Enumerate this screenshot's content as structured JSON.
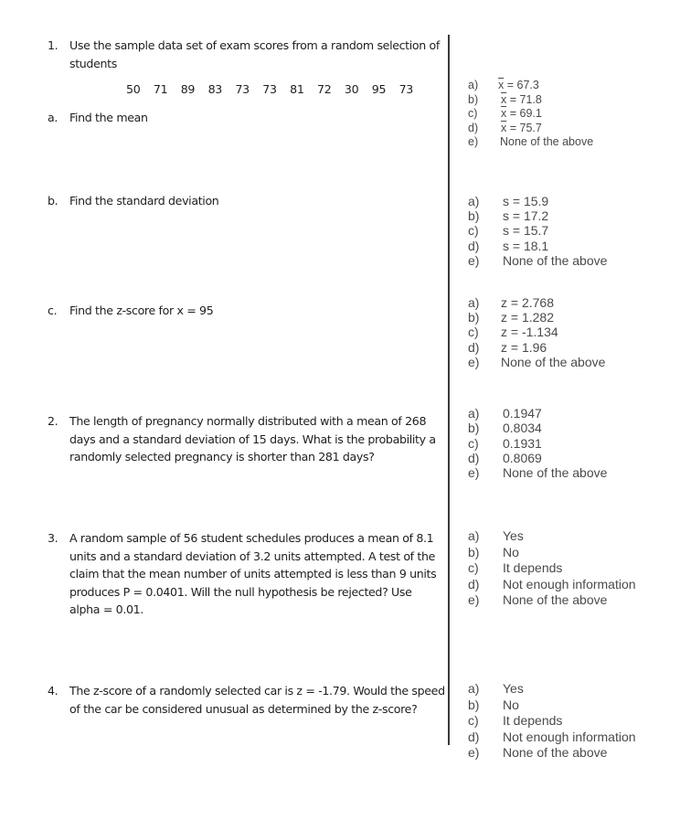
{
  "questions": [
    {
      "number": "1.",
      "text": "Use the sample data set of exam scores from a random selection of students",
      "dataset": [
        "50",
        "71",
        "89",
        "83",
        "73",
        "73",
        "81",
        "72",
        "30",
        "95",
        "73"
      ],
      "parts": [
        {
          "label": "a.",
          "text": "Find the mean",
          "options": [
            {
              "letter": "a)",
              "symbol": "x",
              "text": " = 67.3"
            },
            {
              "letter": "b)",
              "symbol": "x",
              "text": " = 71.8"
            },
            {
              "letter": "c)",
              "symbol": "x",
              "text": " = 69.1"
            },
            {
              "letter": "d)",
              "symbol": "x",
              "text": " = 75.7"
            },
            {
              "letter": "e)",
              "text": "None of the above"
            }
          ]
        },
        {
          "label": "b.",
          "text": "Find the standard deviation",
          "options": [
            {
              "letter": "a)",
              "text": "s = 15.9"
            },
            {
              "letter": "b)",
              "text": "s = 17.2"
            },
            {
              "letter": "c)",
              "text": "s = 15.7"
            },
            {
              "letter": "d)",
              "text": "s = 18.1"
            },
            {
              "letter": "e)",
              "text": "None of the above"
            }
          ]
        },
        {
          "label": "c.",
          "text": "Find the z-score for x = 95",
          "options": [
            {
              "letter": "a)",
              "text": "z = 2.768"
            },
            {
              "letter": "b)",
              "text": "z = 1.282"
            },
            {
              "letter": "c)",
              "text": "z = -1.134"
            },
            {
              "letter": "d)",
              "text": "z = 1.96"
            },
            {
              "letter": "e)",
              "text": "None of the above"
            }
          ]
        }
      ]
    },
    {
      "number": "2.",
      "text": "The length of pregnancy normally distributed with a mean of 268 days and a standard deviation of 15 days.  What is the probability a randomly selected pregnancy is shorter than 281 days?",
      "options": [
        {
          "letter": "a)",
          "text": "0.1947"
        },
        {
          "letter": "b)",
          "text": "0.8034"
        },
        {
          "letter": "c)",
          "text": "0.1931"
        },
        {
          "letter": "d)",
          "text": "0.8069"
        },
        {
          "letter": "e)",
          "text": "None of the above"
        }
      ]
    },
    {
      "number": "3.",
      "text": "A random sample of 56 student schedules produces a mean of 8.1 units and a standard deviation of 3.2 units attempted.  A test of the claim that the mean number of units attempted is less than 9 units produces P = 0.0401.  Will the null hypothesis be rejected?  Use alpha = 0.01.",
      "options": [
        {
          "letter": "a)",
          "text": "Yes"
        },
        {
          "letter": "b)",
          "text": "No"
        },
        {
          "letter": "c)",
          "text": "It depends"
        },
        {
          "letter": "d)",
          "text": "Not enough information"
        },
        {
          "letter": "e)",
          "text": "None of the above"
        }
      ]
    },
    {
      "number": "4.",
      "text": "The z-score of a randomly selected car is z = -1.79.  Would the speed of the car be considered unusual as determined by the z-score?",
      "options": [
        {
          "letter": "a)",
          "text": "Yes"
        },
        {
          "letter": "b)",
          "text": "No"
        },
        {
          "letter": "c)",
          "text": "It depends"
        },
        {
          "letter": "d)",
          "text": "Not enough information"
        },
        {
          "letter": "e)",
          "text": "None of the above"
        }
      ]
    }
  ]
}
